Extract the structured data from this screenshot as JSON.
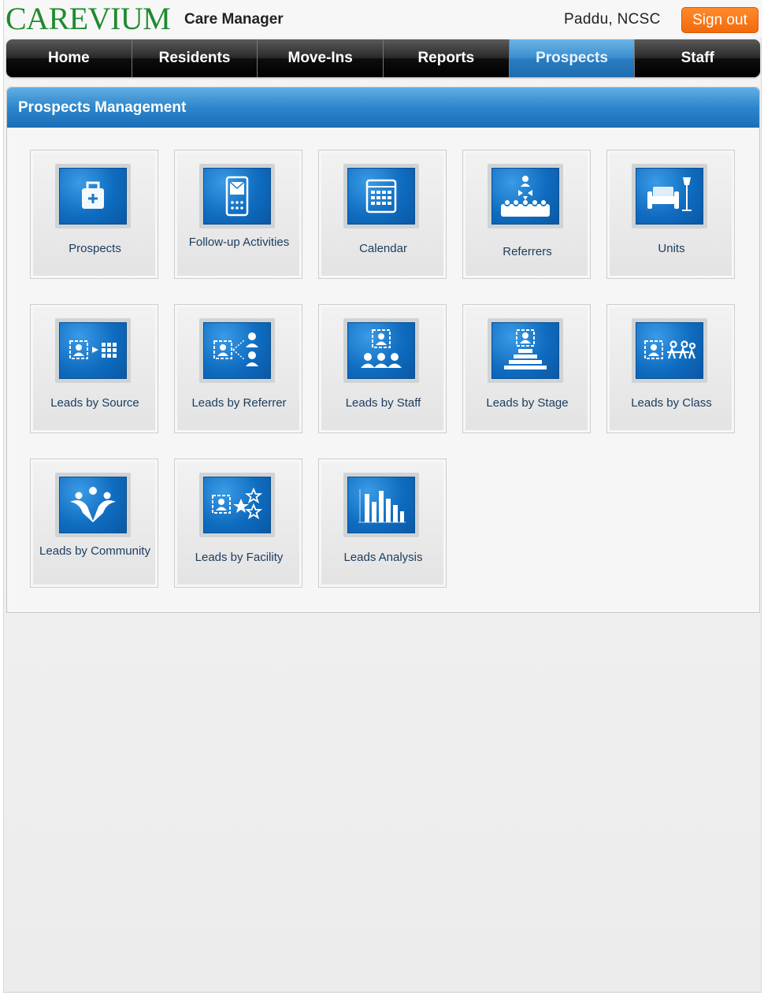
{
  "header": {
    "logo": "CAREVIUM",
    "app_name": "Care Manager",
    "user": "Paddu, NCSC",
    "signout_label": "Sign out"
  },
  "nav": {
    "tabs": [
      {
        "label": "Home",
        "active": false
      },
      {
        "label": "Residents",
        "active": false
      },
      {
        "label": "Move-Ins",
        "active": false
      },
      {
        "label": "Reports",
        "active": false
      },
      {
        "label": "Prospects",
        "active": true
      },
      {
        "label": "Staff",
        "active": false
      }
    ]
  },
  "panel": {
    "title": "Prospects Management",
    "tiles": [
      {
        "label": "Prospects",
        "icon": "medical-bag-icon"
      },
      {
        "label": "Follow-up Activities",
        "icon": "tablet-mail-icon"
      },
      {
        "label": "Calendar",
        "icon": "calendar-icon"
      },
      {
        "label": "Referrers",
        "icon": "referrers-icon"
      },
      {
        "label": "Units",
        "icon": "furniture-icon"
      },
      {
        "label": "Leads by Source",
        "icon": "leads-source-icon"
      },
      {
        "label": "Leads by Referrer",
        "icon": "leads-referrer-icon"
      },
      {
        "label": "Leads by Staff",
        "icon": "leads-staff-icon"
      },
      {
        "label": "Leads by Stage",
        "icon": "leads-stage-icon"
      },
      {
        "label": "Leads by Class",
        "icon": "leads-class-icon"
      },
      {
        "label": "Leads by Community",
        "icon": "community-icon"
      },
      {
        "label": "Leads by Facility",
        "icon": "leads-facility-icon"
      },
      {
        "label": "Leads Analysis",
        "icon": "bar-chart-icon"
      }
    ]
  },
  "colors": {
    "brand_green": "#1f8a2e",
    "signout_orange": "#f26a0c",
    "active_tab_blue": "#2a7cc0",
    "tile_blue": "#0f6cc0"
  }
}
